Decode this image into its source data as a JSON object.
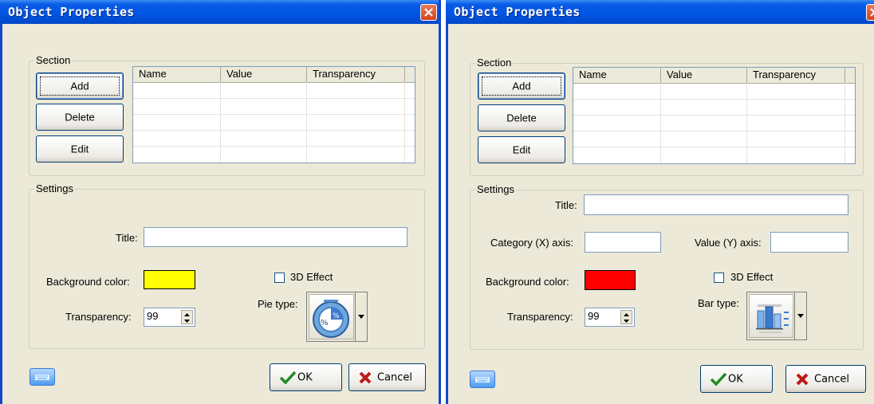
{
  "dialogs": [
    {
      "title": "Object Properties",
      "section_label": "Section",
      "buttons": {
        "add": "Add",
        "delete": "Delete",
        "edit": "Edit"
      },
      "table_headers": [
        "Name",
        "Value",
        "Transparency"
      ],
      "settings_label": "Settings",
      "title_label": "Title:",
      "title_value": "",
      "background_color_label": "Background color:",
      "background_color": "#ffff00",
      "effect_label": "3D Effect",
      "effect_checked": false,
      "transparency_label": "Transparency:",
      "transparency_value": "99",
      "type_label": "Pie type:",
      "type_icon": "pie-chart-percent-icon",
      "ok_label": "OK",
      "cancel_label": "Cancel"
    },
    {
      "title": "Object Properties",
      "section_label": "Section",
      "buttons": {
        "add": "Add",
        "delete": "Delete",
        "edit": "Edit"
      },
      "table_headers": [
        "Name",
        "Value",
        "Transparency"
      ],
      "settings_label": "Settings",
      "title_label": "Title:",
      "title_value": "",
      "category_axis_label": "Category (X) axis:",
      "value_axis_label": "Value (Y) axis:",
      "background_color_label": "Background color:",
      "background_color": "#ff0000",
      "effect_label": "3D Effect",
      "effect_checked": false,
      "transparency_label": "Transparency:",
      "transparency_value": "99",
      "type_label": "Bar type:",
      "type_icon": "bar-chart-icon",
      "ok_label": "OK",
      "cancel_label": "Cancel"
    }
  ],
  "colors": {
    "titlebar": "#0054e3",
    "dialog_bg": "#ece9d8",
    "close_button": "#d6431c"
  }
}
